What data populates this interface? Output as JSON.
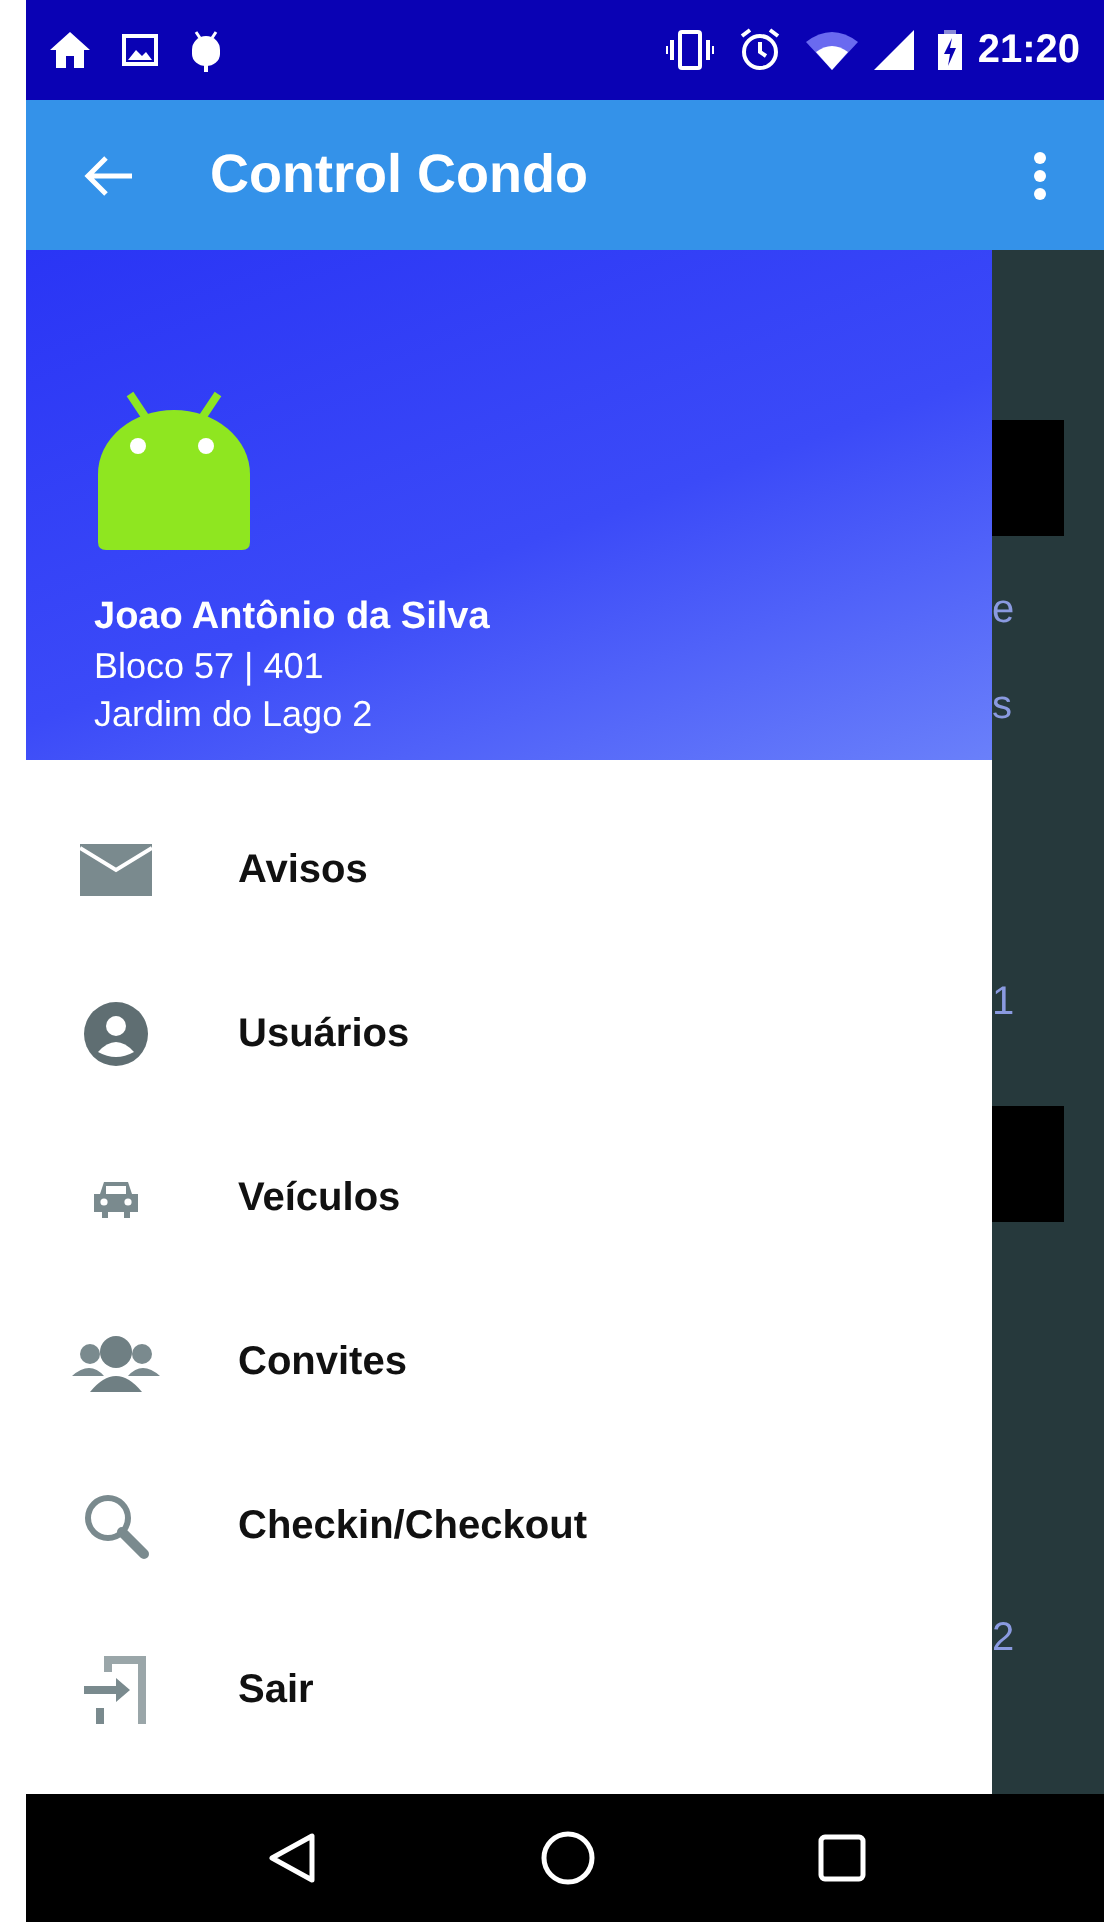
{
  "status_bar": {
    "time": "21:20"
  },
  "app_bar": {
    "title": "Control Condo"
  },
  "drawer": {
    "header": {
      "name": "Joao Antônio da Silva",
      "unit": "Bloco 57 | 401",
      "condo": "Jardim do Lago 2"
    },
    "items": [
      {
        "label": "Avisos"
      },
      {
        "label": "Usuários"
      },
      {
        "label": "Veículos"
      },
      {
        "label": "Convites"
      },
      {
        "label": "Checkin/Checkout"
      },
      {
        "label": "Sair"
      }
    ]
  },
  "background_content": [
    {
      "text": "e"
    },
    {
      "text": "s"
    },
    {
      "text": "1"
    },
    {
      "text": "2"
    }
  ]
}
